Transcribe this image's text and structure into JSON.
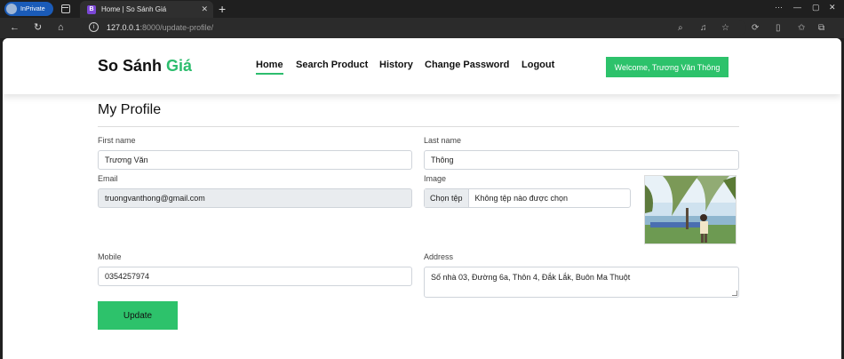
{
  "browser": {
    "inprivate_label": "InPrivate",
    "tab_favicon": "B",
    "tab_title": "Home | So Sánh Giá",
    "url_host": "127.0.0.1",
    "url_path": ":8000/update-profile/"
  },
  "header": {
    "logo_main": "So Sánh",
    "logo_accent": "Giá",
    "nav": {
      "home": "Home",
      "search": "Search Product",
      "history": "History",
      "change_password": "Change Password",
      "logout": "Logout"
    },
    "welcome": "Welcome, Trương Văn Thông"
  },
  "profile": {
    "title": "My Profile",
    "first_name_label": "First name",
    "first_name_value": "Trương Văn",
    "last_name_label": "Last name",
    "last_name_value": "Thông",
    "email_label": "Email",
    "email_value": "truongvanthong@gmail.com",
    "image_label": "Image",
    "file_button": "Chọn tệp",
    "file_status": "Không tệp nào được chọn",
    "mobile_label": "Mobile",
    "mobile_value": "0354257974",
    "address_label": "Address",
    "address_value": "Số nhà 03, Đường 6a, Thôn 4, Đắk Lắk, Buôn Ma Thuột",
    "update_button": "Update"
  },
  "colors": {
    "accent": "#2dc26b"
  }
}
